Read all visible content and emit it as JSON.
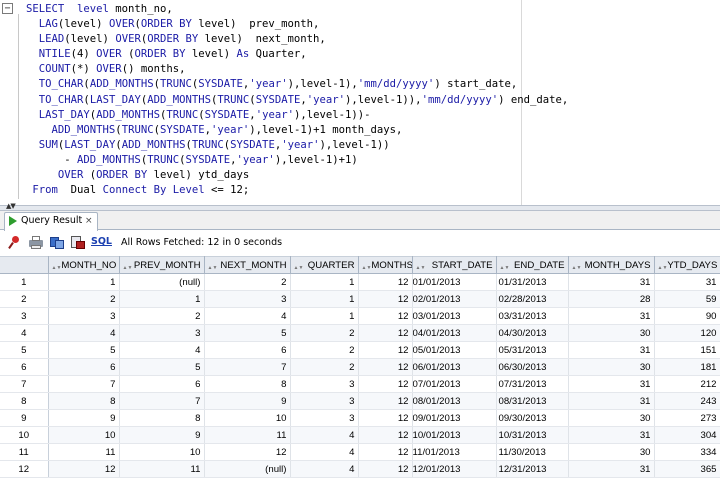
{
  "editor": {
    "lines": [
      [
        {
          "t": "SELECT  ",
          "c": "kw"
        },
        {
          "t": "level",
          "c": "kw"
        },
        {
          "t": " month_no,",
          "c": "op"
        }
      ],
      [
        {
          "t": "  ",
          "c": "op"
        },
        {
          "t": "LAG",
          "c": "fn"
        },
        {
          "t": "(level) ",
          "c": "op"
        },
        {
          "t": "OVER",
          "c": "kw"
        },
        {
          "t": "(",
          "c": "op"
        },
        {
          "t": "ORDER BY",
          "c": "kw"
        },
        {
          "t": " level)  prev_month,",
          "c": "op"
        }
      ],
      [
        {
          "t": "  ",
          "c": "op"
        },
        {
          "t": "LEAD",
          "c": "fn"
        },
        {
          "t": "(level) ",
          "c": "op"
        },
        {
          "t": "OVER",
          "c": "kw"
        },
        {
          "t": "(",
          "c": "op"
        },
        {
          "t": "ORDER BY",
          "c": "kw"
        },
        {
          "t": " level)  next_month,",
          "c": "op"
        }
      ],
      [
        {
          "t": "  ",
          "c": "op"
        },
        {
          "t": "NTILE",
          "c": "fn"
        },
        {
          "t": "(4) ",
          "c": "op"
        },
        {
          "t": "OVER",
          "c": "kw"
        },
        {
          "t": " (",
          "c": "op"
        },
        {
          "t": "ORDER BY",
          "c": "kw"
        },
        {
          "t": " level) ",
          "c": "op"
        },
        {
          "t": "As",
          "c": "kw"
        },
        {
          "t": " Quarter,",
          "c": "op"
        }
      ],
      [
        {
          "t": "  ",
          "c": "op"
        },
        {
          "t": "COUNT",
          "c": "fn"
        },
        {
          "t": "(*) ",
          "c": "op"
        },
        {
          "t": "OVER",
          "c": "kw"
        },
        {
          "t": "() months,",
          "c": "op"
        }
      ],
      [
        {
          "t": "  ",
          "c": "op"
        },
        {
          "t": "TO_CHAR",
          "c": "fn"
        },
        {
          "t": "(",
          "c": "op"
        },
        {
          "t": "ADD_MONTHS",
          "c": "fn"
        },
        {
          "t": "(",
          "c": "op"
        },
        {
          "t": "TRUNC",
          "c": "fn"
        },
        {
          "t": "(",
          "c": "op"
        },
        {
          "t": "SYSDATE",
          "c": "kw"
        },
        {
          "t": ",",
          "c": "op"
        },
        {
          "t": "'year'",
          "c": "str"
        },
        {
          "t": "),level-1),",
          "c": "op"
        },
        {
          "t": "'mm/dd/yyyy'",
          "c": "str"
        },
        {
          "t": ") start_date,",
          "c": "op"
        }
      ],
      [
        {
          "t": "  ",
          "c": "op"
        },
        {
          "t": "TO_CHAR",
          "c": "fn"
        },
        {
          "t": "(",
          "c": "op"
        },
        {
          "t": "LAST_DAY",
          "c": "fn"
        },
        {
          "t": "(",
          "c": "op"
        },
        {
          "t": "ADD_MONTHS",
          "c": "fn"
        },
        {
          "t": "(",
          "c": "op"
        },
        {
          "t": "TRUNC",
          "c": "fn"
        },
        {
          "t": "(",
          "c": "op"
        },
        {
          "t": "SYSDATE",
          "c": "kw"
        },
        {
          "t": ",",
          "c": "op"
        },
        {
          "t": "'year'",
          "c": "str"
        },
        {
          "t": "),level-1)),",
          "c": "op"
        },
        {
          "t": "'mm/dd/yyyy'",
          "c": "str"
        },
        {
          "t": ") end_date,",
          "c": "op"
        }
      ],
      [
        {
          "t": "  ",
          "c": "op"
        },
        {
          "t": "LAST_DAY",
          "c": "fn"
        },
        {
          "t": "(",
          "c": "op"
        },
        {
          "t": "ADD_MONTHS",
          "c": "fn"
        },
        {
          "t": "(",
          "c": "op"
        },
        {
          "t": "TRUNC",
          "c": "fn"
        },
        {
          "t": "(",
          "c": "op"
        },
        {
          "t": "SYSDATE",
          "c": "kw"
        },
        {
          "t": ",",
          "c": "op"
        },
        {
          "t": "'year'",
          "c": "str"
        },
        {
          "t": "),level-1))-",
          "c": "op"
        }
      ],
      [
        {
          "t": "    ",
          "c": "op"
        },
        {
          "t": "ADD_MONTHS",
          "c": "fn"
        },
        {
          "t": "(",
          "c": "op"
        },
        {
          "t": "TRUNC",
          "c": "fn"
        },
        {
          "t": "(",
          "c": "op"
        },
        {
          "t": "SYSDATE",
          "c": "kw"
        },
        {
          "t": ",",
          "c": "op"
        },
        {
          "t": "'year'",
          "c": "str"
        },
        {
          "t": "),level-1)+1 month_days,",
          "c": "op"
        }
      ],
      [
        {
          "t": "  ",
          "c": "op"
        },
        {
          "t": "SUM",
          "c": "fn"
        },
        {
          "t": "(",
          "c": "op"
        },
        {
          "t": "LAST_DAY",
          "c": "fn"
        },
        {
          "t": "(",
          "c": "op"
        },
        {
          "t": "ADD_MONTHS",
          "c": "fn"
        },
        {
          "t": "(",
          "c": "op"
        },
        {
          "t": "TRUNC",
          "c": "fn"
        },
        {
          "t": "(",
          "c": "op"
        },
        {
          "t": "SYSDATE",
          "c": "kw"
        },
        {
          "t": ",",
          "c": "op"
        },
        {
          "t": "'year'",
          "c": "str"
        },
        {
          "t": "),level-1))",
          "c": "op"
        }
      ],
      [
        {
          "t": "      - ",
          "c": "op"
        },
        {
          "t": "ADD_MONTHS",
          "c": "fn"
        },
        {
          "t": "(",
          "c": "op"
        },
        {
          "t": "TRUNC",
          "c": "fn"
        },
        {
          "t": "(",
          "c": "op"
        },
        {
          "t": "SYSDATE",
          "c": "kw"
        },
        {
          "t": ",",
          "c": "op"
        },
        {
          "t": "'year'",
          "c": "str"
        },
        {
          "t": "),level-1)+1)",
          "c": "op"
        }
      ],
      [
        {
          "t": "     ",
          "c": "op"
        },
        {
          "t": "OVER",
          "c": "kw"
        },
        {
          "t": " (",
          "c": "op"
        },
        {
          "t": "ORDER BY",
          "c": "kw"
        },
        {
          "t": " level) ytd_days",
          "c": "op"
        }
      ],
      [
        {
          "t": " ",
          "c": "op"
        },
        {
          "t": "From",
          "c": "kw"
        },
        {
          "t": "  Dual ",
          "c": "op"
        },
        {
          "t": "Connect By Level",
          "c": "kw"
        },
        {
          "t": " <= 12;",
          "c": "op"
        }
      ]
    ]
  },
  "results": {
    "tab_label": "Query Result",
    "tab_close": "×",
    "toolbar": {
      "sql_label": "SQL",
      "status": "All Rows Fetched: 12 in 0 seconds"
    },
    "columns": [
      "MONTH_NO",
      "PREV_MONTH",
      "NEXT_MONTH",
      "QUARTER",
      "MONTHS",
      "START_DATE",
      "END_DATE",
      "MONTH_DAYS",
      "YTD_DAYS"
    ],
    "rows": [
      [
        "1",
        "1",
        "(null)",
        "2",
        "1",
        "12",
        "01/01/2013",
        "01/31/2013",
        "31",
        "31"
      ],
      [
        "2",
        "2",
        "1",
        "3",
        "1",
        "12",
        "02/01/2013",
        "02/28/2013",
        "28",
        "59"
      ],
      [
        "3",
        "3",
        "2",
        "4",
        "1",
        "12",
        "03/01/2013",
        "03/31/2013",
        "31",
        "90"
      ],
      [
        "4",
        "4",
        "3",
        "5",
        "2",
        "12",
        "04/01/2013",
        "04/30/2013",
        "30",
        "120"
      ],
      [
        "5",
        "5",
        "4",
        "6",
        "2",
        "12",
        "05/01/2013",
        "05/31/2013",
        "31",
        "151"
      ],
      [
        "6",
        "6",
        "5",
        "7",
        "2",
        "12",
        "06/01/2013",
        "06/30/2013",
        "30",
        "181"
      ],
      [
        "7",
        "7",
        "6",
        "8",
        "3",
        "12",
        "07/01/2013",
        "07/31/2013",
        "31",
        "212"
      ],
      [
        "8",
        "8",
        "7",
        "9",
        "3",
        "12",
        "08/01/2013",
        "08/31/2013",
        "31",
        "243"
      ],
      [
        "9",
        "9",
        "8",
        "10",
        "3",
        "12",
        "09/01/2013",
        "09/30/2013",
        "30",
        "273"
      ],
      [
        "10",
        "10",
        "9",
        "11",
        "4",
        "12",
        "10/01/2013",
        "10/31/2013",
        "31",
        "304"
      ],
      [
        "11",
        "11",
        "10",
        "12",
        "4",
        "12",
        "11/01/2013",
        "11/30/2013",
        "30",
        "334"
      ],
      [
        "12",
        "12",
        "11",
        "(null)",
        "4",
        "12",
        "12/01/2013",
        "12/31/2013",
        "31",
        "365"
      ]
    ]
  },
  "icons": {
    "fold": "collapse-icon",
    "tab": "play-icon",
    "toolbar": [
      "pin-icon",
      "print-icon",
      "refresh-icon",
      "export-icon"
    ]
  }
}
